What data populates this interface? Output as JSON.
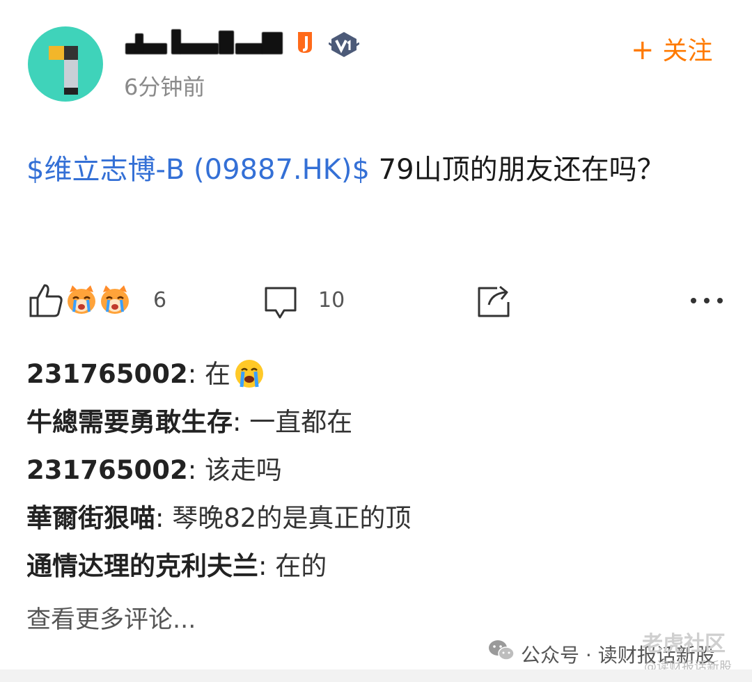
{
  "author": {
    "time": "6分钟前",
    "follow_label": "关注",
    "follow_plus": "+"
  },
  "post": {
    "stock_tag": "$维立志博-B (09887.HK)$",
    "text": " 79山顶的朋友还在吗？"
  },
  "actions": {
    "like_count": "6",
    "comment_count": "10"
  },
  "comments": [
    {
      "user": "231765002",
      "text": "在",
      "emoji": "crying-face"
    },
    {
      "user": "牛總需要勇敢生存",
      "text": "一直都在"
    },
    {
      "user": "231765002",
      "text": "该走吗"
    },
    {
      "user": "華爾街狠喵",
      "text": "琴晚82的是真正的顶"
    },
    {
      "user": "通情达理的克利夫兰",
      "text": "在的"
    }
  ],
  "view_more": "查看更多评论...",
  "watermark": {
    "channel": "公众号 · 读财报话新股",
    "logo": "老虎社区",
    "sub": "@读财报话新股"
  },
  "colors": {
    "accent_orange": "#ff7a00",
    "stock_link_blue": "#3470d6",
    "avatar_teal": "#3fd3ba"
  }
}
